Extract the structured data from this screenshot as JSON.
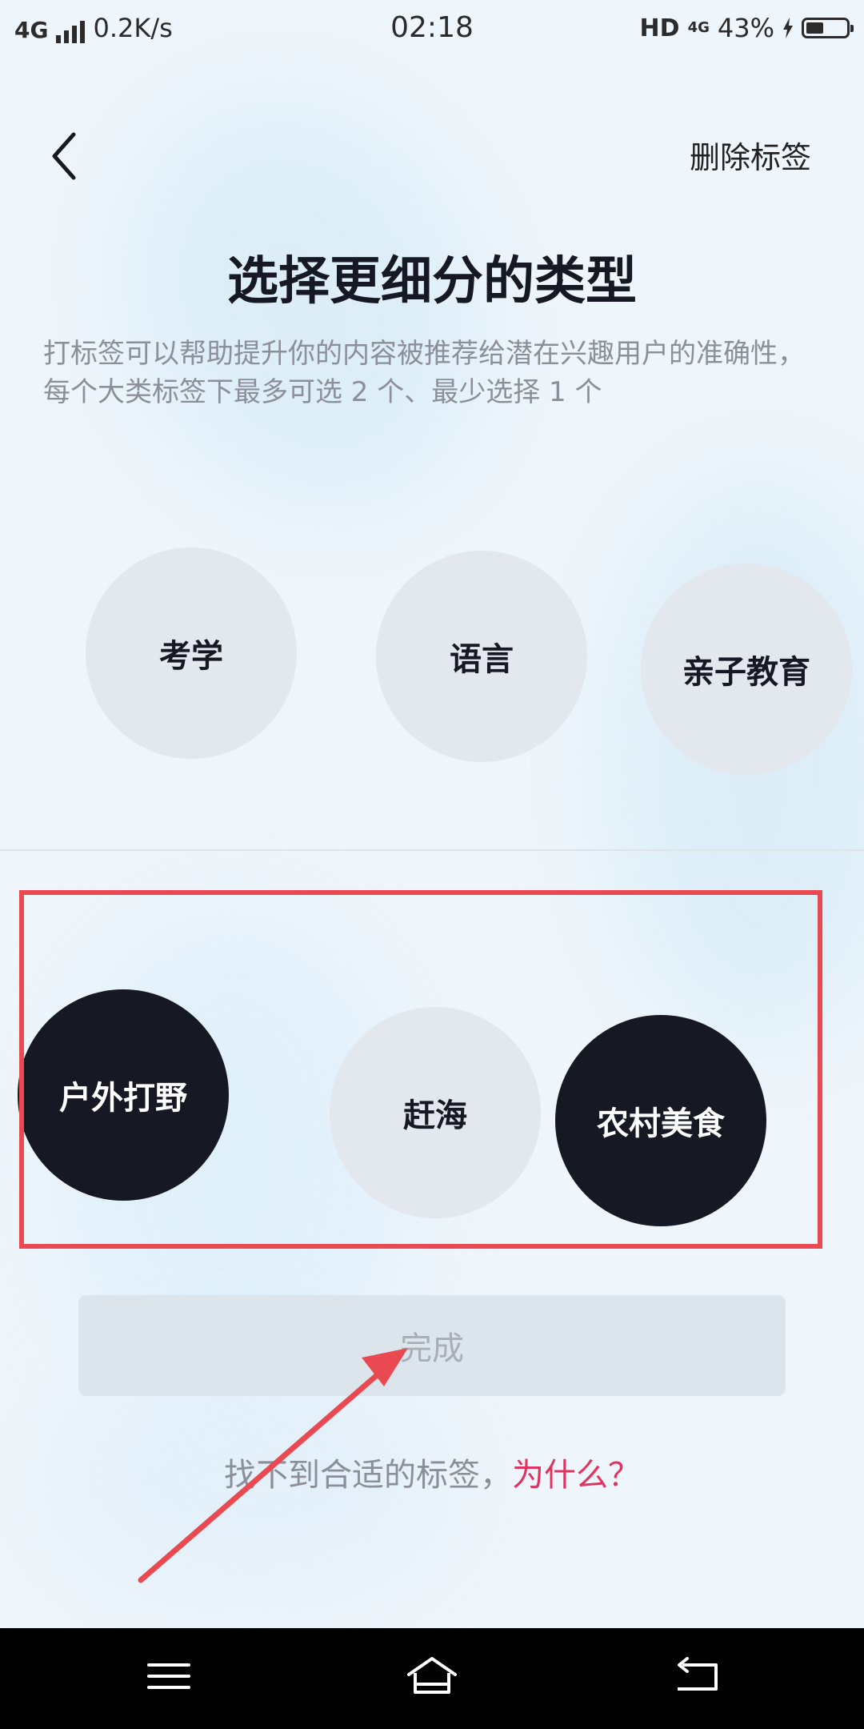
{
  "status_bar": {
    "network": "4G",
    "speed": "0.2K/s",
    "time": "02:18",
    "hd": "HD",
    "network_type": "4G",
    "battery": "43%",
    "battery_level": 0.43
  },
  "header": {
    "delete_label": "删除标签"
  },
  "main": {
    "title": "选择更细分的类型",
    "description": "打标签可以帮助提升你的内容被推荐给潜在兴趣用户的准确性，每个大类标签下最多可选 2 个、最少选择 1 个"
  },
  "tag_groups": [
    {
      "tags": [
        {
          "label": "考学",
          "selected": false
        },
        {
          "label": "语言",
          "selected": false
        },
        {
          "label": "亲子教育",
          "selected": false
        }
      ]
    },
    {
      "tags": [
        {
          "label": "户外打野",
          "selected": true
        },
        {
          "label": "赶海",
          "selected": false
        },
        {
          "label": "农村美食",
          "selected": true
        }
      ]
    }
  ],
  "done_button": {
    "label": "完成"
  },
  "footer": {
    "hint": "找不到合适的标签，",
    "why_link": "为什么？"
  },
  "colors": {
    "annotation": "#e94a51",
    "selected_tag": "#161823",
    "link": "#e0335f"
  },
  "navbar": {
    "icons": [
      "menu-icon",
      "home-icon",
      "back-icon"
    ]
  }
}
